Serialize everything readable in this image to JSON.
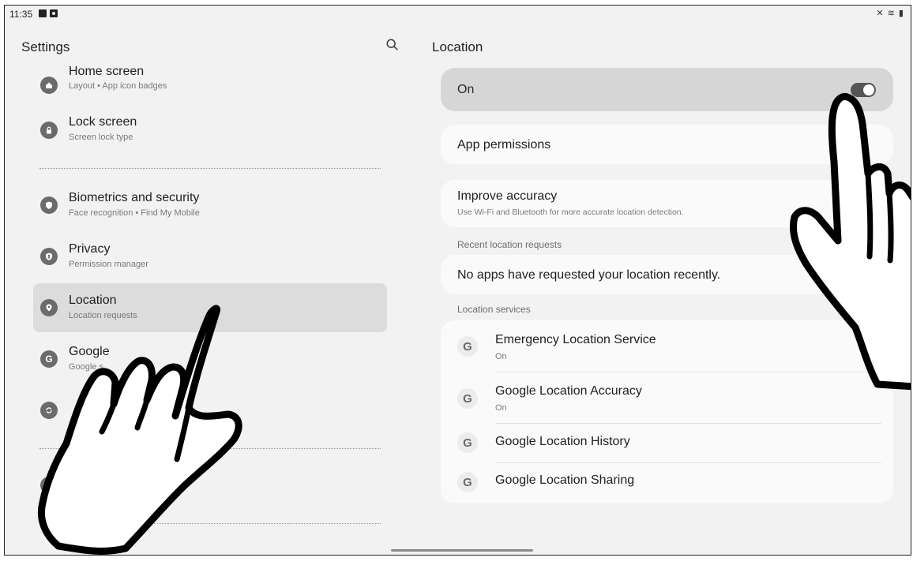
{
  "status_bar": {
    "time": "11:35",
    "left_icons": [
      "gallery-icon",
      "notification-icon"
    ],
    "right_icons_text": "✕ ≋ ▮"
  },
  "left_pane": {
    "title": "Settings",
    "menu_items": [
      {
        "title": "Home screen",
        "subtitle": "Layout  •  App icon badges",
        "icon": "home-icon",
        "active": false
      },
      {
        "title": "Lock screen",
        "subtitle": "Screen lock type",
        "icon": "lock-icon",
        "active": false
      },
      {
        "title": "Biometrics and security",
        "subtitle": "Face recognition  •  Find My Mobile",
        "icon": "shield-icon",
        "active": false
      },
      {
        "title": "Privacy",
        "subtitle": "Permission manager",
        "icon": "privacy-icon",
        "active": false
      },
      {
        "title": "Location",
        "subtitle": "Location requests",
        "icon": "location-pin-icon",
        "active": true
      },
      {
        "title": "Google",
        "subtitle": "Google s",
        "icon": "google-icon",
        "active": false
      }
    ]
  },
  "right_pane": {
    "title": "Location",
    "master_switch": {
      "label": "On",
      "state": "on"
    },
    "app_permissions_label": "App permissions",
    "improve_accuracy": {
      "label": "Improve accuracy",
      "subtitle": "Use Wi-Fi and Bluetooth for more accurate location detection."
    },
    "recent_header": "Recent location requests",
    "recent_empty_text": "No apps have requested your location recently.",
    "services_header": "Location services",
    "services": [
      {
        "title": "Emergency Location Service",
        "subtitle": "On"
      },
      {
        "title": "Google Location Accuracy",
        "subtitle": "On"
      },
      {
        "title": "Google Location History",
        "subtitle": ""
      },
      {
        "title": "Google Location Sharing",
        "subtitle": ""
      }
    ]
  },
  "colors": {
    "background": "#f2f2f2",
    "card": "#fafafa",
    "active_item": "#dcdcdc",
    "master_card": "#d6d6d6",
    "toggle_on": "#555555"
  }
}
